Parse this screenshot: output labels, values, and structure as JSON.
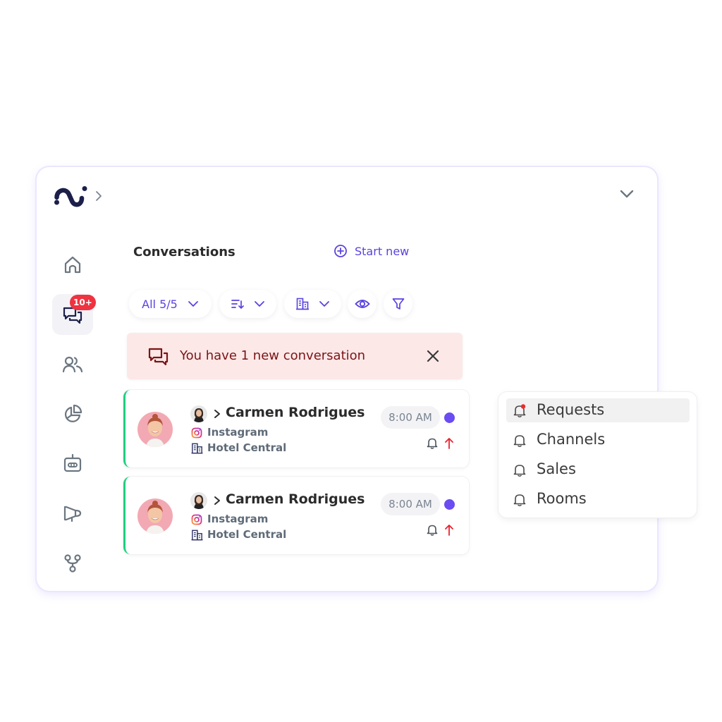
{
  "header": {
    "logo": "logo-mark",
    "breadcrumb_chevron": "chevron-right-icon",
    "collapse_chevron": "chevron-down-icon"
  },
  "sidebar": {
    "items": [
      {
        "name": "home",
        "icon": "home-icon",
        "active": false
      },
      {
        "name": "conversations",
        "icon": "chat-bubbles-icon",
        "active": true,
        "badge": "10+"
      },
      {
        "name": "contacts",
        "icon": "users-icon",
        "active": false
      },
      {
        "name": "reports",
        "icon": "pie-chart-icon",
        "active": false
      },
      {
        "name": "bots",
        "icon": "robot-icon",
        "active": false
      },
      {
        "name": "campaigns",
        "icon": "megaphone-icon",
        "active": false
      },
      {
        "name": "integrations",
        "icon": "flow-icon",
        "active": false
      }
    ]
  },
  "main": {
    "title": "Conversations",
    "start_new_label": "Start new",
    "filters": {
      "all_label": "All 5/5",
      "sort_icon": "sort-icon",
      "property_icon": "building-icon",
      "view_icon": "eye-icon",
      "filter_icon": "filter-icon"
    },
    "alert": {
      "text": "You have 1 new conversation",
      "icon": "chat-bubbles-icon",
      "close_icon": "close-icon"
    },
    "conversations": [
      {
        "contact_name": "Carmen Rodrigues",
        "channel": "Instagram",
        "property": "Hotel Central",
        "time": "8:00 AM",
        "unread": true,
        "priority": "high"
      },
      {
        "contact_name": "Carmen Rodrigues",
        "channel": "Instagram",
        "property": "Hotel Central",
        "time": "8:00 AM",
        "unread": true,
        "priority": "high"
      }
    ]
  },
  "notifications_menu": {
    "items": [
      {
        "label": "Requests",
        "selected": true,
        "has_alert": true
      },
      {
        "label": "Channels",
        "selected": false,
        "has_alert": false
      },
      {
        "label": "Sales",
        "selected": false,
        "has_alert": false
      },
      {
        "label": "Rooms",
        "selected": false,
        "has_alert": false
      }
    ]
  },
  "colors": {
    "accent": "#5a43e0",
    "brand_navy": "#1c1f4a",
    "badge_red": "#ef3340",
    "unread_dot": "#6a4cf2",
    "status_green": "#1fcf7f",
    "alert_bg": "#fde8e8",
    "alert_text": "#7a1515",
    "icon_gray": "#6b7680"
  }
}
